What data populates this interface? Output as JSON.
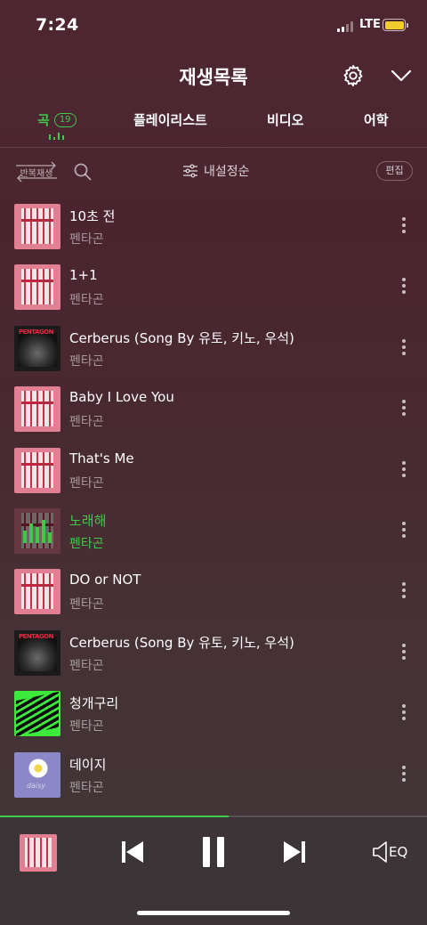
{
  "status_bar": {
    "time": "7:24",
    "network": "LTE",
    "battery_color": "#f2cc2e"
  },
  "header": {
    "title": "재생목록",
    "icons": [
      "gear-icon",
      "chevron-down-icon"
    ]
  },
  "tabs": [
    {
      "label": "곡",
      "badge": "19",
      "active": true
    },
    {
      "label": "플레이리스트",
      "active": false
    },
    {
      "label": "비디오",
      "active": false
    },
    {
      "label": "어학",
      "active": false
    }
  ],
  "toolbar": {
    "repeat_label": "반복재생",
    "sort_label": "내설정순",
    "edit_label": "편집"
  },
  "tracks": [
    {
      "title": "10초 전",
      "artist": "펜타곤",
      "art": "pink",
      "playing": false
    },
    {
      "title": "1+1",
      "artist": "펜타곤",
      "art": "pink",
      "playing": false
    },
    {
      "title": "Cerberus (Song By 유토, 키노, 우석)",
      "artist": "펜타곤",
      "art": "dark",
      "playing": false
    },
    {
      "title": "Baby I Love You",
      "artist": "펜타곤",
      "art": "pink",
      "playing": false
    },
    {
      "title": "That's Me",
      "artist": "펜타곤",
      "art": "pink",
      "playing": false
    },
    {
      "title": "노래해",
      "artist": "펜타곤",
      "art": "pink",
      "playing": true
    },
    {
      "title": "DO or NOT",
      "artist": "펜타곤",
      "art": "pink",
      "playing": false
    },
    {
      "title": "Cerberus (Song By 유토, 키노, 우석)",
      "artist": "펜타곤",
      "art": "dark",
      "playing": false
    },
    {
      "title": "청개구리",
      "artist": "펜타곤",
      "art": "green",
      "playing": false
    },
    {
      "title": "데이지",
      "artist": "펜타곤",
      "art": "lavender",
      "playing": false
    }
  ],
  "player": {
    "progress": 0.535,
    "eq_label": "EQ",
    "accent_color": "#3ec94b"
  }
}
